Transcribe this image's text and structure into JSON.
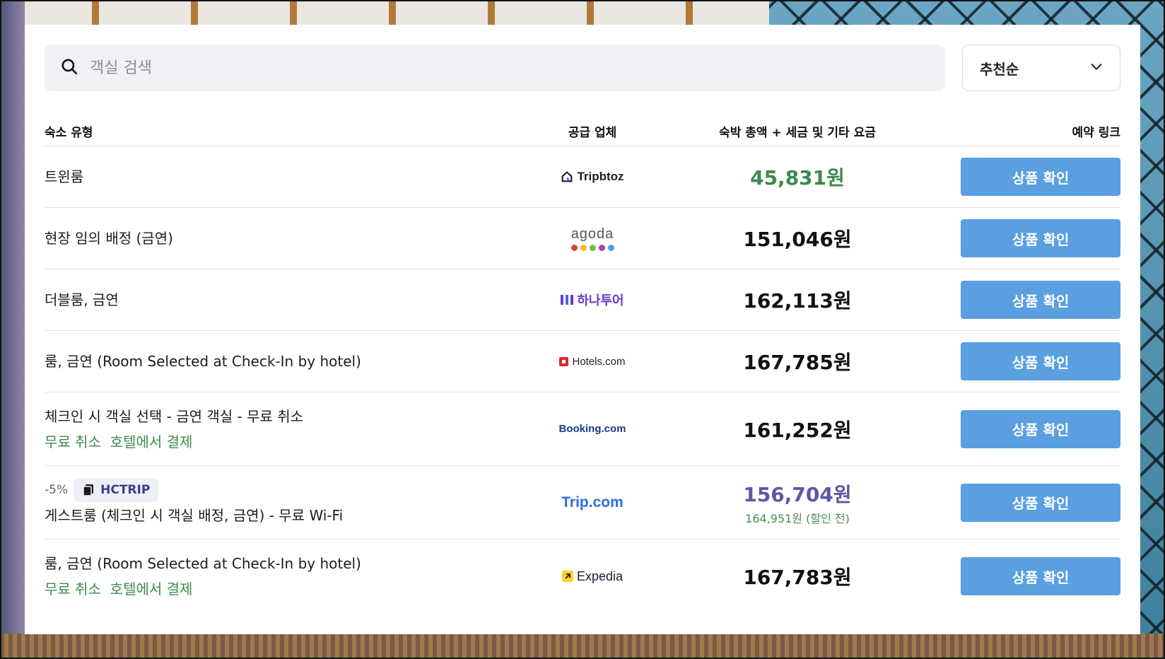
{
  "search": {
    "placeholder": "객실 검색"
  },
  "sort": {
    "selected": "추천순"
  },
  "table": {
    "headers": {
      "type": "숙소 유형",
      "vendor": "공급 업체",
      "price": "숙박 총액 + 세금 및 기타 요금",
      "link": "예약 링크"
    },
    "rows": [
      {
        "type": "트윈룸",
        "vendor": "Tripbtoz",
        "price": "45,831원",
        "button": "상품 확인"
      },
      {
        "type": "현장 임의 배정 (금연)",
        "vendor": "agoda",
        "price": "151,046원",
        "button": "상품 확인"
      },
      {
        "type": "더블룸, 금연",
        "vendor": "하나투어",
        "price": "162,113원",
        "button": "상품 확인"
      },
      {
        "type": "룸, 금연 (Room Selected at Check-In by hotel)",
        "vendor": "Hotels.com",
        "price": "167,785원",
        "button": "상품 확인"
      },
      {
        "type": "체크인 시 객실 선택 - 금연 객실 - 무료 취소",
        "tags": "무료 취소  호텔에서 결제",
        "vendor": "Booking.com",
        "price": "161,252원",
        "button": "상품 확인"
      },
      {
        "discount": "-5%",
        "coupon": "HCTRIP",
        "type": "게스트룸 (체크인 시 객실 배정, 금연) - 무료 Wi-Fi",
        "vendor": "Trip.com",
        "price": "156,704원",
        "orig_price": "164,951원 (할인 전)",
        "button": "상품 확인"
      },
      {
        "type": "룸, 금연 (Room Selected at Check-In by hotel)",
        "tags": "무료 취소  호텔에서 결제",
        "vendor": "Expedia",
        "price": "167,783원",
        "button": "상품 확인"
      }
    ]
  },
  "colors": {
    "button": "#5a9fdf",
    "price_best": "#3d8a4a",
    "price_coupon": "#5b57a6",
    "tag_green": "#3d8a4a"
  }
}
